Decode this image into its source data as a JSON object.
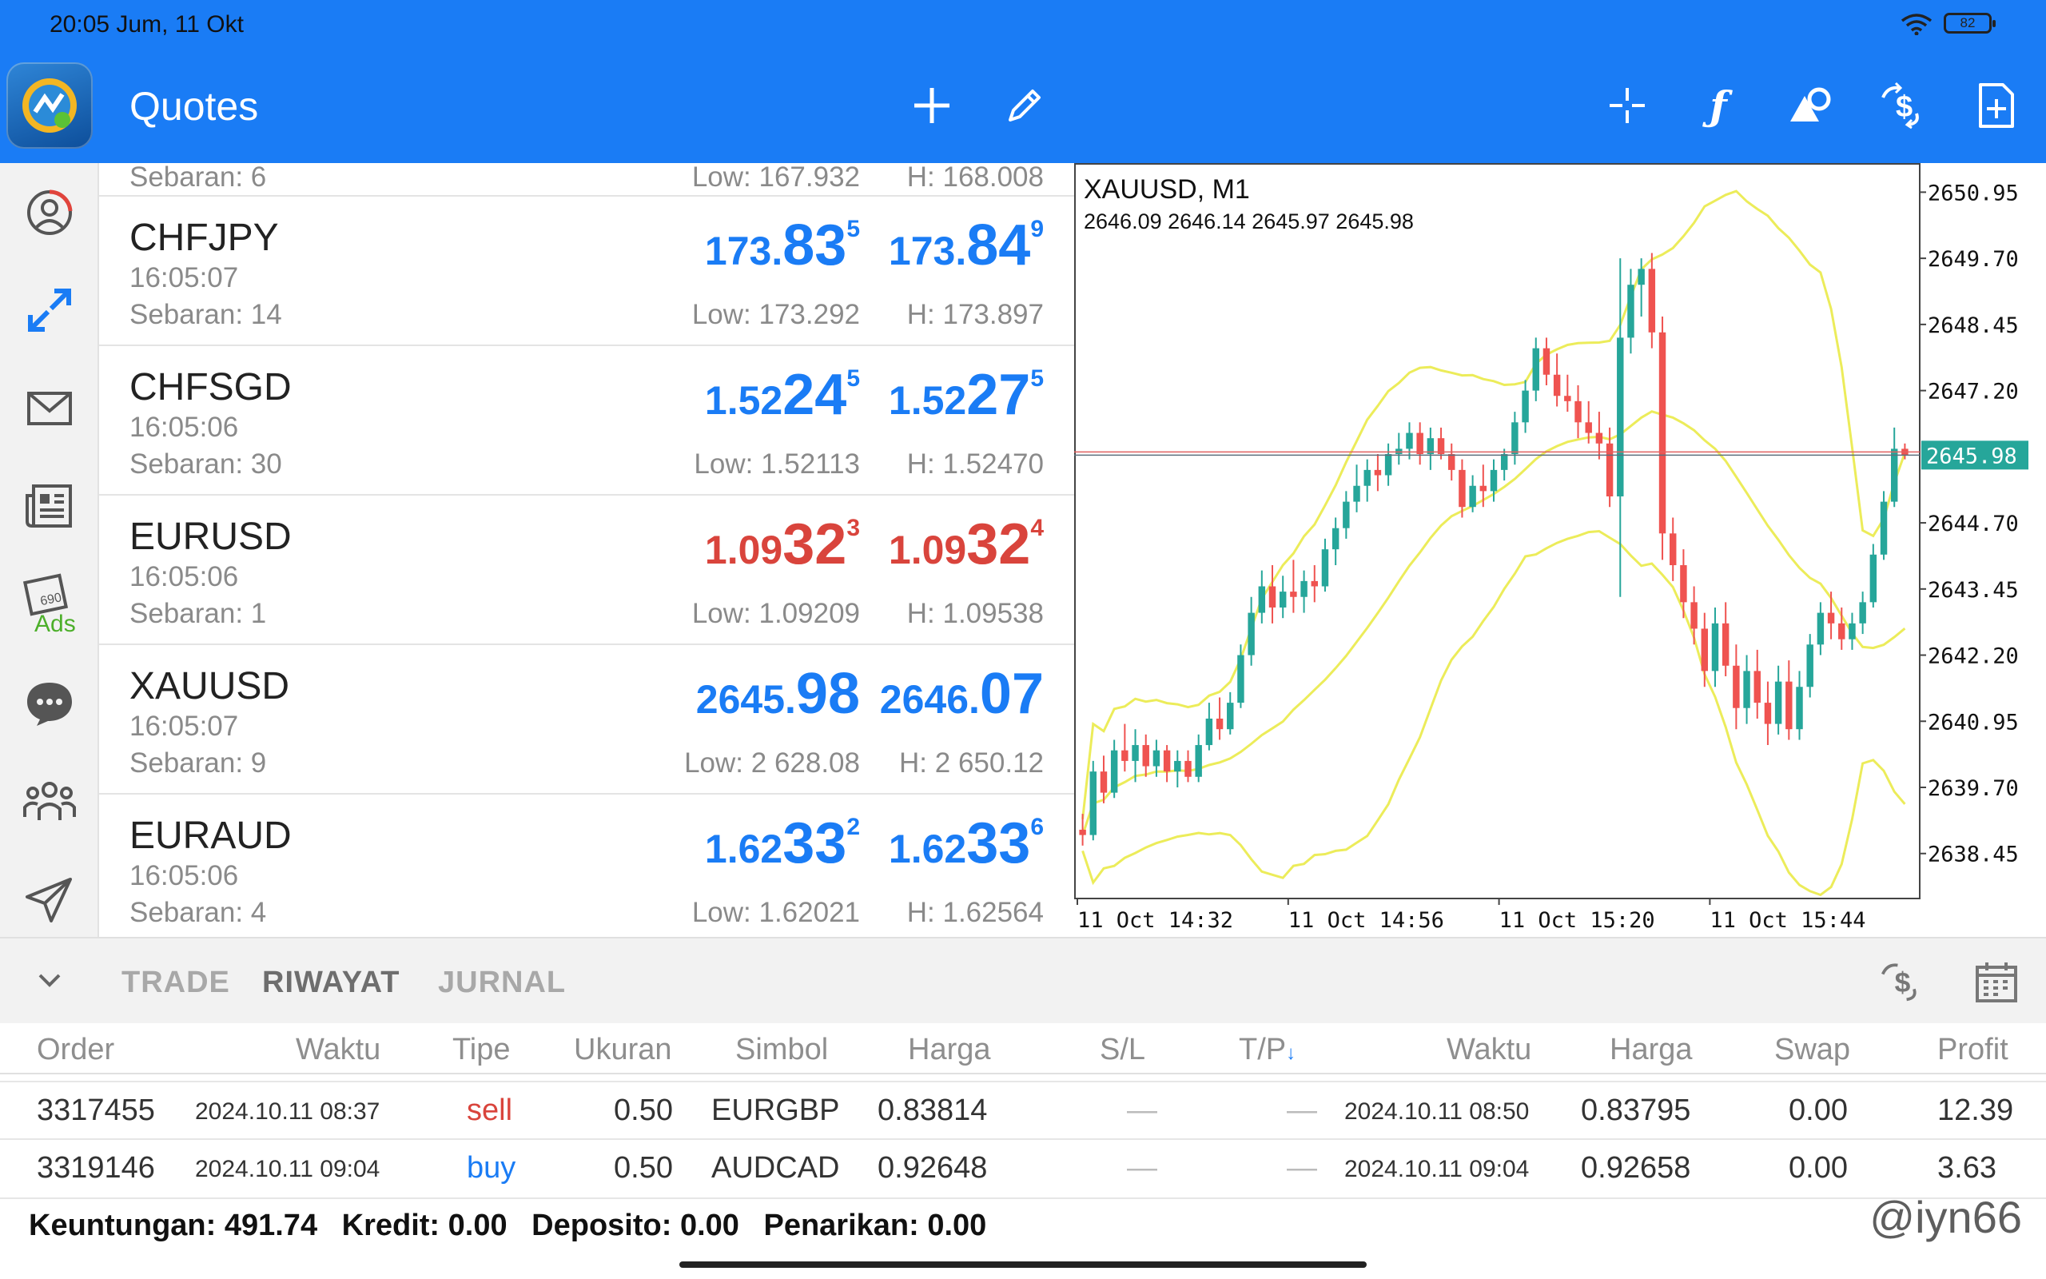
{
  "status": {
    "time": "20:05 Jum, 11 Okt",
    "battery": "82"
  },
  "appbar": {
    "title": "Quotes"
  },
  "quotes_partial": {
    "spread": "Sebaran: 6",
    "low": "Low: 167.932",
    "high": "H: 168.008"
  },
  "quotes": [
    {
      "symbol": "CHFJPY",
      "time": "16:05:07",
      "spread": "Sebaran: 14",
      "bid": {
        "pre": "173.",
        "big": "83",
        "sup": "5",
        "color": "#1a7cf5"
      },
      "ask": {
        "pre": "173.",
        "big": "84",
        "sup": "9",
        "color": "#1a7cf5"
      },
      "low": "Low: 173.292",
      "high": "H: 173.897"
    },
    {
      "symbol": "CHFSGD",
      "time": "16:05:06",
      "spread": "Sebaran: 30",
      "bid": {
        "pre": "1.52",
        "big": "24",
        "sup": "5",
        "color": "#1a7cf5"
      },
      "ask": {
        "pre": "1.52",
        "big": "27",
        "sup": "5",
        "color": "#1a7cf5"
      },
      "low": "Low: 1.52113",
      "high": "H: 1.52470"
    },
    {
      "symbol": "EURUSD",
      "time": "16:05:06",
      "spread": "Sebaran: 1",
      "bid": {
        "pre": "1.09",
        "big": "32",
        "sup": "3",
        "color": "#d9443c"
      },
      "ask": {
        "pre": "1.09",
        "big": "32",
        "sup": "4",
        "color": "#d9443c"
      },
      "low": "Low: 1.09209",
      "high": "H: 1.09538"
    },
    {
      "symbol": "XAUUSD",
      "time": "16:05:07",
      "spread": "Sebaran: 9",
      "bid": {
        "pre": "2645.",
        "big": "98",
        "sup": "",
        "color": "#1a7cf5"
      },
      "ask": {
        "pre": "2646.",
        "big": "07",
        "sup": "",
        "color": "#1a7cf5"
      },
      "low": "Low: 2 628.08",
      "high": "H: 2 650.12"
    },
    {
      "symbol": "EURAUD",
      "time": "16:05:06",
      "spread": "Sebaran: 4",
      "bid": {
        "pre": "1.62",
        "big": "33",
        "sup": "2",
        "color": "#1a7cf5"
      },
      "ask": {
        "pre": "1.62",
        "big": "33",
        "sup": "6",
        "color": "#1a7cf5"
      },
      "low": "Low: 1.62021",
      "high": "H: 1.62564"
    }
  ],
  "chart": {
    "symbol": "XAUUSD, M1",
    "ohlc": "2646.09 2646.14 2645.97 2645.98",
    "current_price": "2645.98",
    "price_labels": [
      "2650.95",
      "2649.70",
      "2648.45",
      "2647.20",
      "2644.70",
      "2643.45",
      "2642.20",
      "2640.95",
      "2639.70",
      "2638.45"
    ],
    "time_labels": [
      "11 Oct 14:32",
      "11 Oct 14:56",
      "11 Oct 15:20",
      "11 Oct 15:44"
    ],
    "colors": {
      "up": "#26a69a",
      "down": "#ef5350",
      "band": "#ecec5a",
      "price_line": "#26a69a",
      "bid_line": "#e06060"
    }
  },
  "chart_data": {
    "type": "candlestick",
    "title": "XAUUSD, M1",
    "ylim": [
      2637.6,
      2651.5
    ],
    "y_ticks": [
      2650.95,
      2649.7,
      2648.45,
      2647.2,
      2645.98,
      2644.7,
      2643.45,
      2642.2,
      2640.95,
      2639.7,
      2638.45
    ],
    "x_ticks": [
      "11 Oct 14:32",
      "11 Oct 14:56",
      "11 Oct 15:20",
      "11 Oct 15:44"
    ],
    "candles": [
      [
        2638.9,
        2639.2,
        2638.6,
        2638.8
      ],
      [
        2638.8,
        2640.2,
        2638.7,
        2640.0
      ],
      [
        2640.0,
        2640.3,
        2639.4,
        2639.6
      ],
      [
        2639.6,
        2640.6,
        2639.5,
        2640.4
      ],
      [
        2640.4,
        2640.9,
        2640.0,
        2640.2
      ],
      [
        2640.2,
        2640.8,
        2639.8,
        2640.5
      ],
      [
        2640.5,
        2640.7,
        2639.9,
        2640.1
      ],
      [
        2640.1,
        2640.6,
        2639.9,
        2640.4
      ],
      [
        2640.4,
        2640.5,
        2639.8,
        2640.0
      ],
      [
        2640.0,
        2640.4,
        2639.7,
        2640.2
      ],
      [
        2640.2,
        2640.4,
        2639.8,
        2639.9
      ],
      [
        2639.9,
        2640.7,
        2639.8,
        2640.5
      ],
      [
        2640.5,
        2641.3,
        2640.4,
        2641.0
      ],
      [
        2641.0,
        2641.4,
        2640.6,
        2640.8
      ],
      [
        2640.8,
        2641.5,
        2640.7,
        2641.3
      ],
      [
        2641.3,
        2642.4,
        2641.2,
        2642.2
      ],
      [
        2642.2,
        2643.3,
        2642.0,
        2643.0
      ],
      [
        2643.0,
        2643.8,
        2642.8,
        2643.5
      ],
      [
        2643.5,
        2643.9,
        2642.8,
        2643.1
      ],
      [
        2643.1,
        2643.7,
        2642.9,
        2643.4
      ],
      [
        2643.4,
        2644.0,
        2643.0,
        2643.3
      ],
      [
        2643.3,
        2643.8,
        2643.0,
        2643.6
      ],
      [
        2643.6,
        2643.9,
        2643.2,
        2643.5
      ],
      [
        2643.5,
        2644.4,
        2643.4,
        2644.2
      ],
      [
        2644.2,
        2644.8,
        2643.9,
        2644.6
      ],
      [
        2644.6,
        2645.3,
        2644.4,
        2645.1
      ],
      [
        2645.1,
        2645.8,
        2644.9,
        2645.4
      ],
      [
        2645.4,
        2645.9,
        2645.1,
        2645.7
      ],
      [
        2645.7,
        2646.0,
        2645.3,
        2645.6
      ],
      [
        2645.6,
        2646.2,
        2645.4,
        2646.0
      ],
      [
        2646.0,
        2646.4,
        2645.8,
        2646.1
      ],
      [
        2646.1,
        2646.6,
        2645.9,
        2646.4
      ],
      [
        2646.4,
        2646.6,
        2645.8,
        2646.0
      ],
      [
        2646.0,
        2646.5,
        2645.7,
        2646.3
      ],
      [
        2646.3,
        2646.5,
        2645.9,
        2646.0
      ],
      [
        2646.0,
        2646.2,
        2645.5,
        2645.7
      ],
      [
        2645.7,
        2645.9,
        2644.8,
        2645.0
      ],
      [
        2645.0,
        2645.6,
        2644.9,
        2645.4
      ],
      [
        2645.4,
        2645.8,
        2645.0,
        2645.3
      ],
      [
        2645.3,
        2645.9,
        2645.1,
        2645.7
      ],
      [
        2645.7,
        2646.1,
        2645.5,
        2646.0
      ],
      [
        2646.0,
        2646.8,
        2645.8,
        2646.6
      ],
      [
        2646.6,
        2647.4,
        2646.4,
        2647.2
      ],
      [
        2647.2,
        2648.2,
        2647.0,
        2648.0
      ],
      [
        2648.0,
        2648.2,
        2647.3,
        2647.5
      ],
      [
        2647.5,
        2647.9,
        2646.9,
        2647.1
      ],
      [
        2647.1,
        2647.5,
        2646.8,
        2647.0
      ],
      [
        2647.0,
        2647.3,
        2646.3,
        2646.6
      ],
      [
        2646.6,
        2647.0,
        2646.2,
        2646.4
      ],
      [
        2646.4,
        2646.8,
        2645.9,
        2646.2
      ],
      [
        2646.2,
        2646.5,
        2645.0,
        2645.2
      ],
      [
        2645.2,
        2649.7,
        2643.3,
        2648.2
      ],
      [
        2648.2,
        2649.5,
        2647.9,
        2649.2
      ],
      [
        2649.2,
        2649.7,
        2648.6,
        2649.5
      ],
      [
        2649.5,
        2649.8,
        2648.0,
        2648.3
      ],
      [
        2648.3,
        2648.6,
        2644.0,
        2644.5
      ],
      [
        2644.5,
        2644.8,
        2643.6,
        2643.9
      ],
      [
        2643.9,
        2644.2,
        2642.9,
        2643.2
      ],
      [
        2643.2,
        2643.5,
        2642.4,
        2642.7
      ],
      [
        2642.7,
        2643.0,
        2641.6,
        2641.9
      ],
      [
        2641.9,
        2643.1,
        2641.6,
        2642.8
      ],
      [
        2642.8,
        2643.2,
        2641.8,
        2642.0
      ],
      [
        2642.0,
        2642.4,
        2640.8,
        2641.2
      ],
      [
        2641.2,
        2642.2,
        2640.9,
        2641.9
      ],
      [
        2641.9,
        2642.3,
        2641.0,
        2641.3
      ],
      [
        2641.3,
        2641.7,
        2640.5,
        2640.9
      ],
      [
        2640.9,
        2642.0,
        2640.7,
        2641.7
      ],
      [
        2641.7,
        2642.1,
        2640.6,
        2640.8
      ],
      [
        2640.8,
        2641.9,
        2640.6,
        2641.6
      ],
      [
        2641.6,
        2642.6,
        2641.4,
        2642.4
      ],
      [
        2642.4,
        2643.2,
        2642.2,
        2643.0
      ],
      [
        2643.0,
        2643.4,
        2642.5,
        2642.8
      ],
      [
        2642.8,
        2643.1,
        2642.3,
        2642.5
      ],
      [
        2642.5,
        2643.0,
        2642.3,
        2642.8
      ],
      [
        2642.8,
        2643.4,
        2642.6,
        2643.2
      ],
      [
        2643.2,
        2644.3,
        2643.1,
        2644.1
      ],
      [
        2644.1,
        2645.3,
        2644.0,
        2645.1
      ],
      [
        2645.1,
        2646.5,
        2645.0,
        2646.1
      ],
      [
        2646.1,
        2646.2,
        2645.9,
        2645.98
      ]
    ]
  },
  "panel": {
    "tabs": [
      "TRADE",
      "RIWAYAT",
      "JURNAL"
    ],
    "columns": [
      "Order",
      "Waktu",
      "Tipe",
      "Ukuran",
      "Simbol",
      "Harga",
      "S/L",
      "T/P",
      "Waktu",
      "Harga",
      "Swap",
      "Profit"
    ],
    "rows": [
      {
        "order": "3317455",
        "open_time": "2024.10.11 08:37",
        "type": "sell",
        "type_color": "#d9443c",
        "size": "0.50",
        "symbol": "EURGBP",
        "price": "0.83814",
        "sl": "—",
        "tp": "—",
        "close_time": "2024.10.11 08:50",
        "close_price": "0.83795",
        "swap": "0.00",
        "profit": "12.39"
      },
      {
        "order": "3319146",
        "open_time": "2024.10.11 09:04",
        "type": "buy",
        "type_color": "#1a7cf5",
        "size": "0.50",
        "symbol": "AUDCAD",
        "price": "0.92648",
        "sl": "—",
        "tp": "—",
        "close_time": "2024.10.11 09:04",
        "close_price": "0.92658",
        "swap": "0.00",
        "profit": "3.63"
      }
    ],
    "summary": {
      "profit": "Keuntungan: 491.74",
      "credit": "Kredit: 0.00",
      "deposit": "Deposito: 0.00",
      "withdrawal": "Penarikan: 0.00"
    },
    "watermark": "@iyn66"
  }
}
